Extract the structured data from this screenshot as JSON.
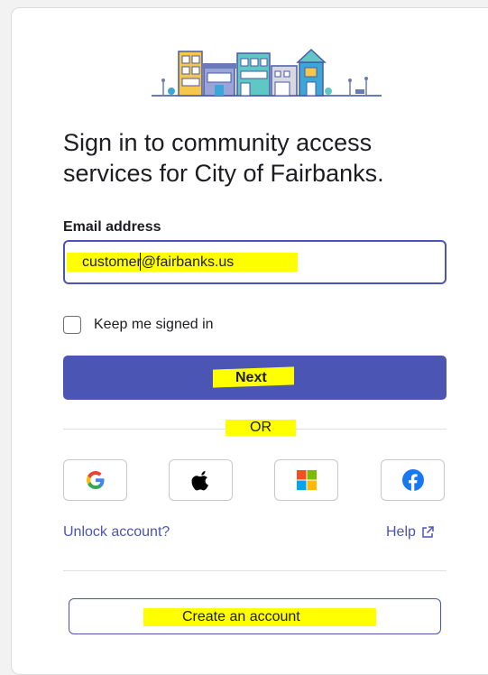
{
  "signin": {
    "title": "Sign in to community access services for City of Fairbanks.",
    "email_label": "Email address",
    "email_value": "customer@fairbanks.us",
    "keep_signed_in": "Keep me signed in",
    "keep_signed_in_checked": false,
    "next_label": "Next",
    "or_label": "OR",
    "unlock_link": "Unlock account?",
    "help_link": "Help",
    "create_account": "Create an account"
  },
  "social_providers": [
    {
      "name": "google",
      "icon": "google-icon"
    },
    {
      "name": "apple",
      "icon": "apple-icon"
    },
    {
      "name": "microsoft",
      "icon": "microsoft-icon"
    },
    {
      "name": "facebook",
      "icon": "facebook-icon"
    }
  ],
  "colors": {
    "accent": "#4b55b4",
    "highlight": "#ffff00",
    "text": "#1d1d21"
  }
}
